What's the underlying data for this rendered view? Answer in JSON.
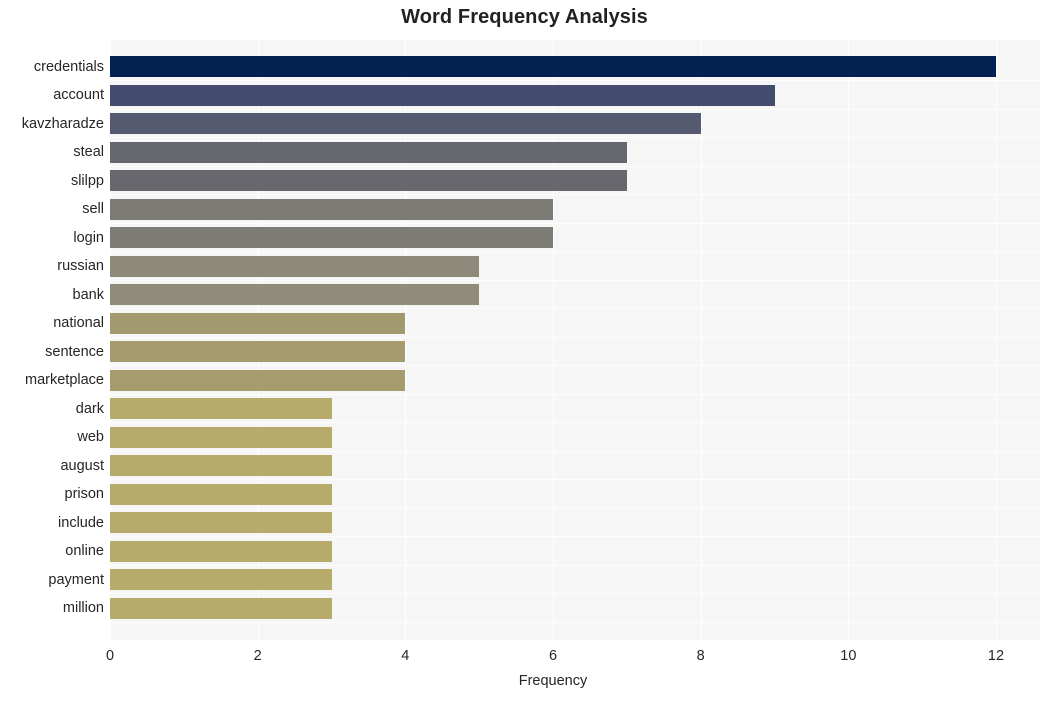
{
  "chart_data": {
    "type": "bar",
    "orientation": "horizontal",
    "title": "Word Frequency Analysis",
    "xlabel": "Frequency",
    "ylabel": "",
    "categories": [
      "credentials",
      "account",
      "kavzharadze",
      "steal",
      "slilpp",
      "sell",
      "login",
      "russian",
      "bank",
      "national",
      "sentence",
      "marketplace",
      "dark",
      "web",
      "august",
      "prison",
      "include",
      "online",
      "payment",
      "million"
    ],
    "values": [
      12,
      9,
      8,
      7,
      7,
      6,
      6,
      5,
      5,
      4,
      4,
      4,
      3,
      3,
      3,
      3,
      3,
      3,
      3,
      3
    ],
    "bar_colors": [
      "#042251",
      "#444c6e",
      "#565a70",
      "#66666e",
      "#68676e",
      "#7b7a75",
      "#7d7b75",
      "#8e8a79",
      "#918c79",
      "#a3996f",
      "#a59b6f",
      "#a69c6e",
      "#b6ab6b",
      "#b6ab6b",
      "#b6ab6b",
      "#b6ab6b",
      "#b6ab6b",
      "#b6ab6b",
      "#b6ab6b",
      "#b6ab6b"
    ],
    "xlim": [
      0,
      12
    ],
    "xticks": [
      0,
      2,
      4,
      6,
      8,
      10,
      12
    ],
    "xtick_labels": [
      "0",
      "2",
      "4",
      "6",
      "8",
      "10",
      "12"
    ],
    "grid": true,
    "grid_axis": "both",
    "legend": false,
    "plot_background": "#f6f6f7",
    "figure_background": "#ffffff",
    "gridline_color": "#ffffff",
    "text_color": "#262626"
  }
}
